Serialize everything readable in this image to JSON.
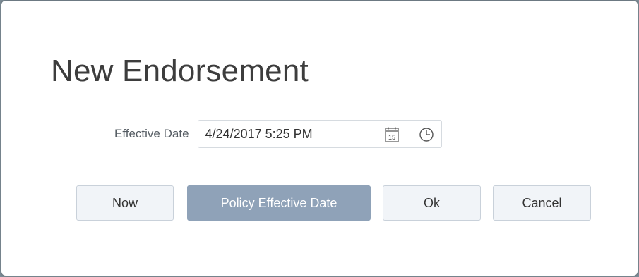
{
  "dialog": {
    "title": "New Endorsement",
    "effective_date": {
      "label": "Effective Date",
      "value": "4/24/2017 5:25 PM",
      "calendar_day": "15",
      "calendar_icon": "calendar-icon",
      "clock_icon": "clock-icon"
    },
    "buttons": {
      "now": "Now",
      "policy_effective_date": "Policy Effective Date",
      "ok": "Ok",
      "cancel": "Cancel"
    }
  },
  "colors": {
    "primary_button": "#8fa2b8",
    "secondary_button": "#f1f4f8",
    "title_text": "#3d3d3d"
  }
}
